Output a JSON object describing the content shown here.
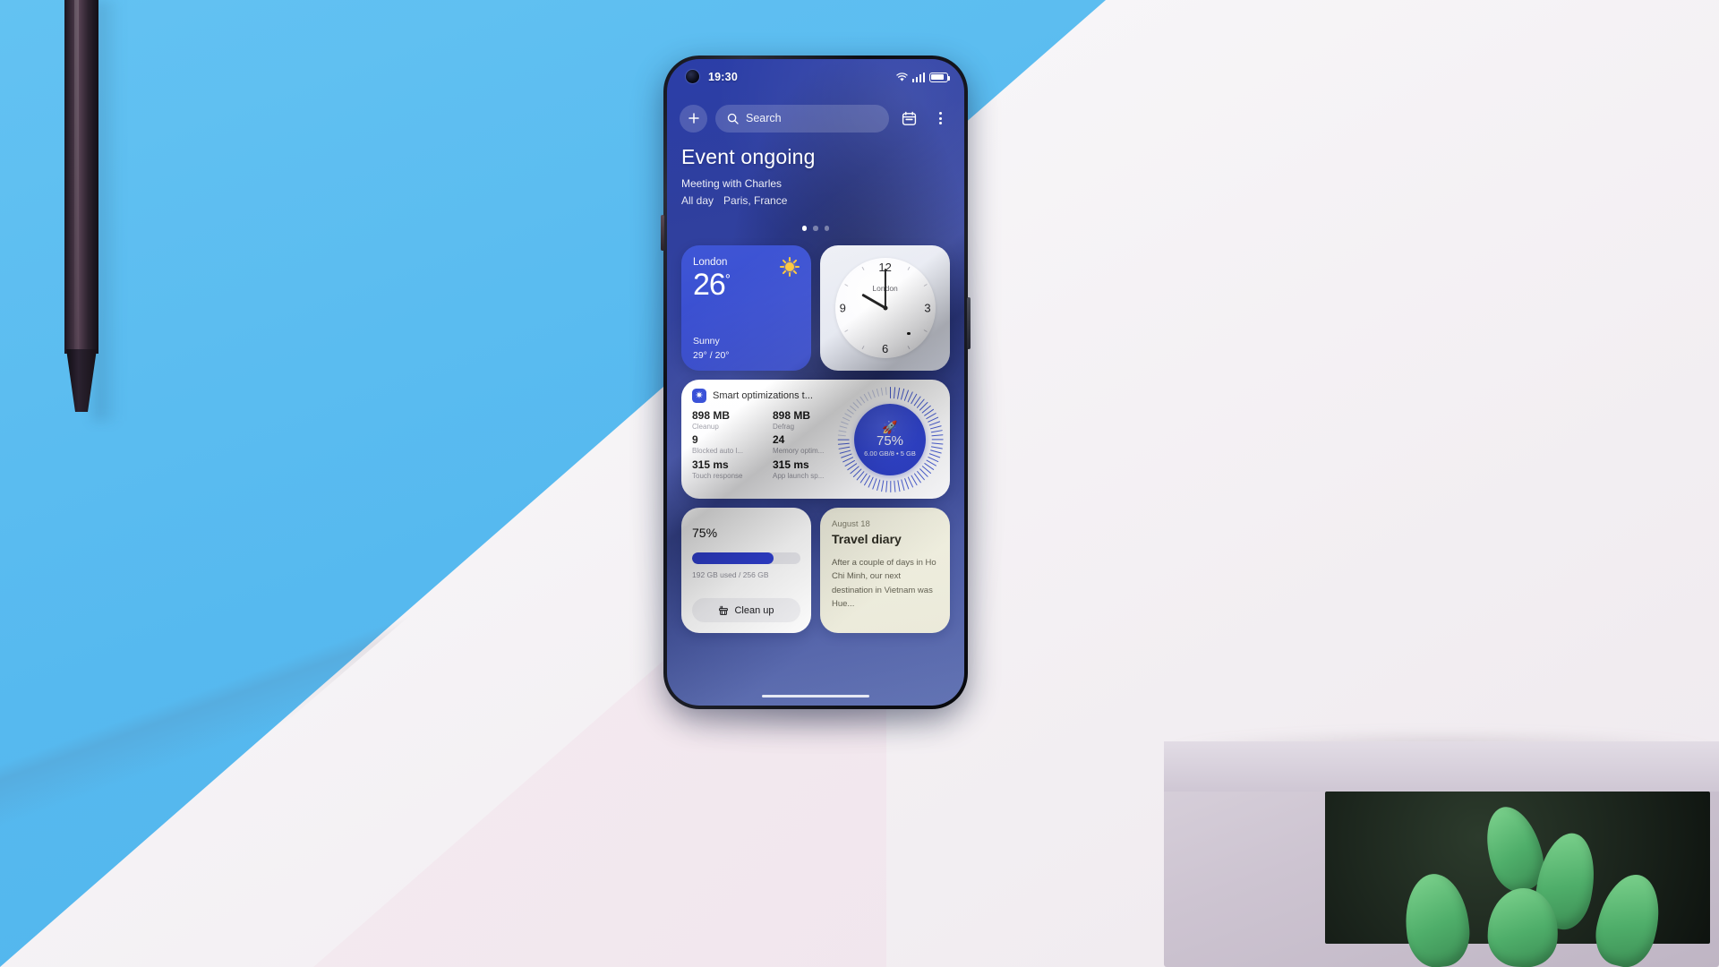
{
  "scene": {
    "background_blue": "#56b9ef",
    "background_white": "#f4f1f4",
    "background_pink": "#f1e6ed",
    "objects": [
      "stylus",
      "concrete-planter",
      "succulent-plant"
    ]
  },
  "phone": {
    "status_bar": {
      "time": "19:30",
      "icons": [
        "wifi-icon",
        "cellular-signal-icon",
        "battery-icon"
      ]
    },
    "topbar": {
      "add_label": "+",
      "search_placeholder": "Search",
      "calendar_icon": "calendar-icon",
      "overflow_icon": "more-vertical-icon"
    },
    "event": {
      "title": "Event ongoing",
      "subtitle": "Meeting with Charles",
      "duration": "All day",
      "location": "Paris, France"
    },
    "pager": {
      "total": 3,
      "active": 1
    },
    "widgets": {
      "weather": {
        "city": "London",
        "temperature": "26",
        "degree": "°",
        "condition": "Sunny",
        "high_low": "29° / 20°",
        "icon": "sun-icon",
        "accent": "#3a4fd0"
      },
      "clock": {
        "city": "London",
        "numerals": [
          "12",
          "3",
          "6",
          "9"
        ],
        "time_shown": "10:00"
      },
      "optimization": {
        "title": "Smart optimizations t...",
        "app_icon": "optimizer-icon",
        "stats": [
          {
            "value": "898 MB",
            "label": "Cleanup"
          },
          {
            "value": "898 MB",
            "label": "Defrag"
          },
          {
            "value": "9",
            "label": "Blocked auto l..."
          },
          {
            "value": "24",
            "label": "Memory optim..."
          },
          {
            "value": "315 ms",
            "label": "Touch response"
          },
          {
            "value": "315 ms",
            "label": "App launch sp..."
          }
        ],
        "gauge": {
          "percent": "75%",
          "percent_value": 75,
          "detail": "6.00 GB/8 • 5 GB",
          "icon": "rocket-icon"
        }
      },
      "storage": {
        "percent": "75",
        "percent_symbol": "%",
        "percent_value": 75,
        "detail": "192 GB used / 256 GB",
        "button_label": "Clean up",
        "button_icon": "broom-icon"
      },
      "note": {
        "date": "August 18",
        "title": "Travel diary",
        "body": "After a couple of days in Ho Chi Minh, our next destination in Vietnam was Hue..."
      }
    }
  }
}
